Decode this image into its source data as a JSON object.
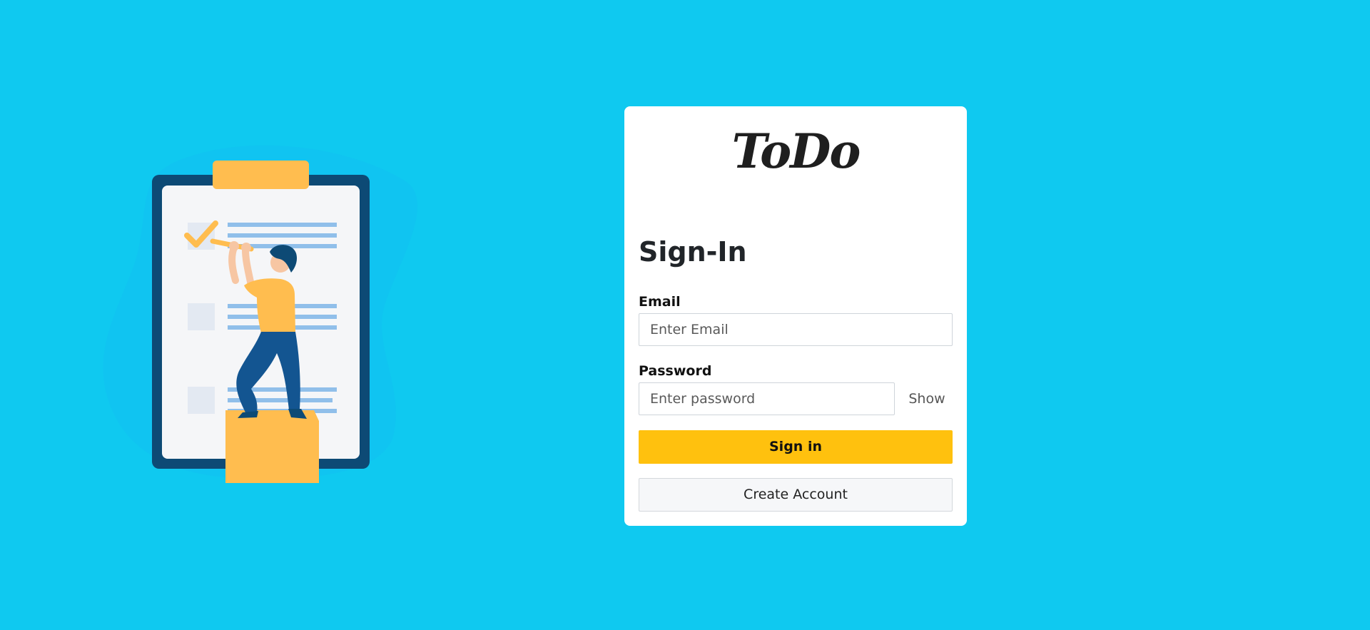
{
  "logo": {
    "text": "ToDo"
  },
  "form": {
    "title": "Sign-In",
    "email_label": "Email",
    "email_placeholder": "Enter Email",
    "email_value": "",
    "password_label": "Password",
    "password_placeholder": "Enter password",
    "password_value": "",
    "show_label": "Show",
    "signin_label": "Sign in",
    "create_label": "Create Account"
  },
  "colors": {
    "background": "#0fc9f0",
    "accent": "#ffc10e",
    "clipboard": "#0d4a75",
    "figure_shirt": "#ffbd4f",
    "figure_pants": "#135591"
  },
  "illustration": {
    "icon": "checklist-illustration",
    "checked_items": 1,
    "total_items": 3
  }
}
